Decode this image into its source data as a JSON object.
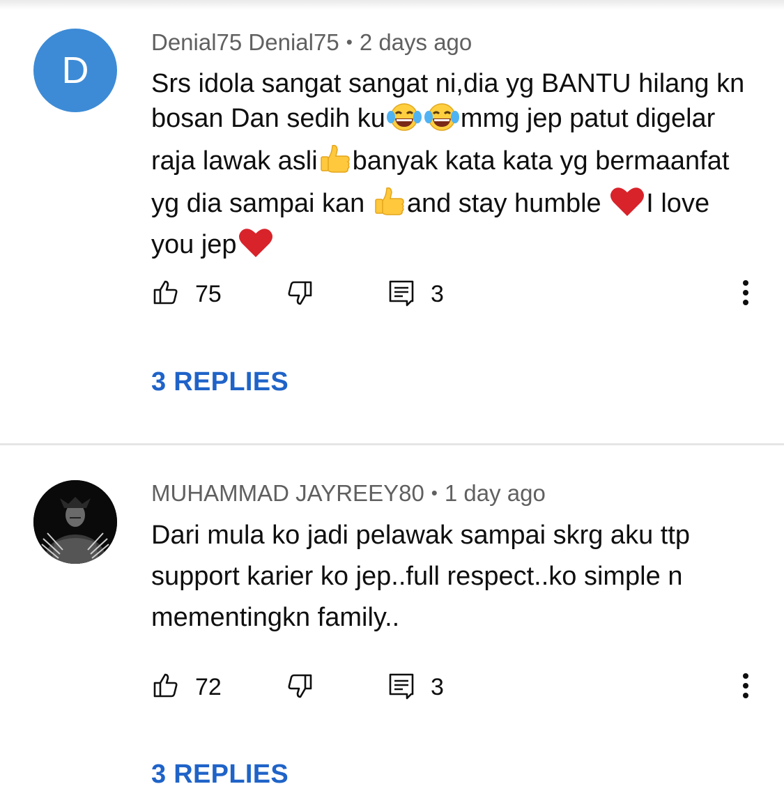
{
  "comments": [
    {
      "author": "Denial75 Denial75",
      "age": "2 days ago",
      "avatar_letter": "D",
      "avatar_color": "#3d8bd6",
      "text_parts": [
        "Srs idola sangat sangat ni,dia yg BANTU hilang kn bosan Dan sedih ku",
        "mmg jep patut digelar raja lawak asli",
        "banyak kata kata yg bermaanfat yg dia sampai kan ",
        "and stay humble ",
        "I love you jep"
      ],
      "emojis": [
        "laughing-tears-emoji",
        "laughing-tears-emoji",
        "thumbs-up-emoji",
        "thumbs-up-emoji",
        "red-heart-emoji",
        "red-heart-emoji"
      ],
      "likes": "75",
      "reply_count": "3",
      "replies_label": "3 REPLIES"
    },
    {
      "author": "MUHAMMAD JAYREEY80",
      "age": "1 day ago",
      "avatar_icon": "dark-figure-portrait",
      "text": "Dari mula ko jadi pelawak sampai skrg aku ttp support karier ko jep..full respect..ko simple n mementingkn family..",
      "likes": "72",
      "reply_count": "3",
      "replies_label": "3 REPLIES"
    }
  ],
  "colors": {
    "link_blue": "#1f63c8",
    "meta_gray": "#606060",
    "divider": "#e5e5e5"
  }
}
